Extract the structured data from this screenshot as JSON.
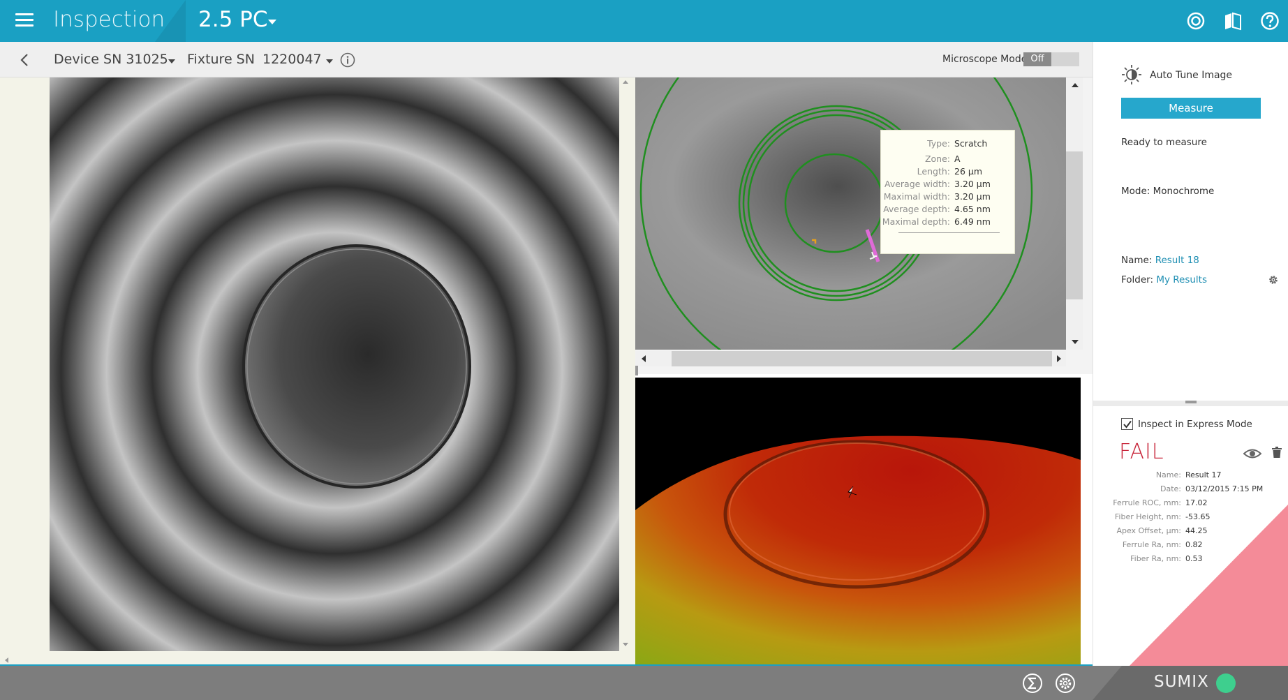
{
  "header": {
    "app_title": "Inspection",
    "connector_type": "2.5 PC",
    "icons": [
      "target-icon",
      "book-icon",
      "help-icon"
    ]
  },
  "toolbar": {
    "device_label": "Device SN 31025",
    "fixture_label": "Fixture SN",
    "fixture_value": "1220047",
    "microscope_mode_label": "Microscope Mode",
    "microscope_mode_value": "Off"
  },
  "tooltip": {
    "rows": [
      {
        "key": "Type:",
        "value": "Scratch"
      },
      {
        "key": "Zone:",
        "value": "A"
      },
      {
        "key": "Length:",
        "value": "26 µm"
      },
      {
        "key": "Average width:",
        "value": "3.20 µm"
      },
      {
        "key": "Maximal width:",
        "value": "3.20 µm"
      },
      {
        "key": "Average depth:",
        "value": "4.65 nm"
      },
      {
        "key": "Maximal depth:",
        "value": "6.49 nm"
      }
    ]
  },
  "sidebar": {
    "auto_tune_label": "Auto Tune Image",
    "measure_label": "Measure",
    "status": "Ready to measure",
    "mode": "Mode: Monochrome",
    "name_label": "Name:",
    "name_value": "Result 18",
    "folder_label": "Folder:",
    "folder_value": "My Results",
    "express_label": "Inspect in Express Mode",
    "express_checked": true,
    "verdict": "FAIL",
    "verdict_color": "#c8253a",
    "results": [
      {
        "key": "Name:",
        "value": "Result 17"
      },
      {
        "key": "Date:",
        "value": "03/12/2015 7:15 PM"
      },
      {
        "key": "Ferrule ROC, mm:",
        "value": "17.02"
      },
      {
        "key": "Fiber Height, nm:",
        "value": "-53.65"
      },
      {
        "key": "Apex Offset, µm:",
        "value": "44.25"
      },
      {
        "key": "Ferrule Ra, nm:",
        "value": "0.82"
      },
      {
        "key": "Fiber Ra, nm:",
        "value": "0.53"
      }
    ]
  },
  "footer": {
    "brand": "SUMIX",
    "icons": [
      "sigma-icon",
      "settings-icon"
    ]
  },
  "colors": {
    "accent": "#1aa0c3",
    "fail": "#c8253a",
    "link": "#1f8fb3",
    "brand_dot": "#3ecf8e"
  }
}
